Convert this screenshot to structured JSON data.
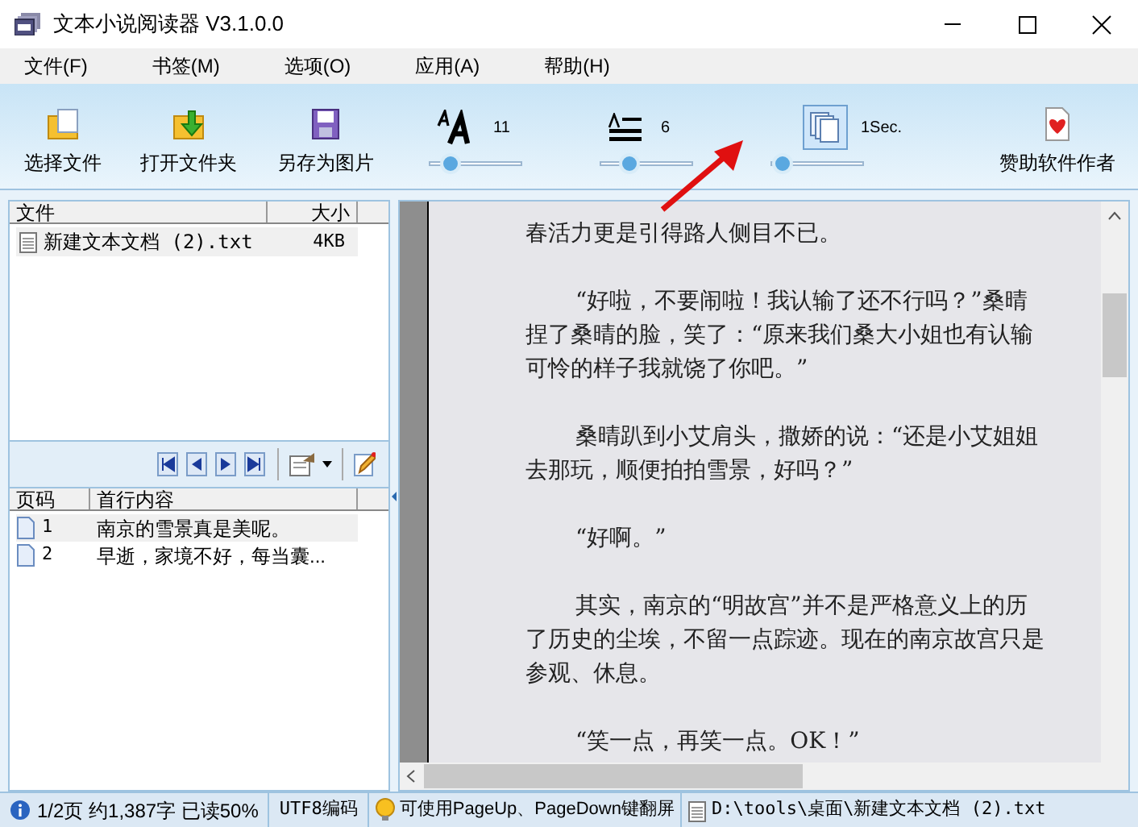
{
  "window": {
    "title": "文本小说阅读器 V3.1.0.0"
  },
  "menu": [
    "文件(F)",
    "书签(M)",
    "选项(O)",
    "应用(A)",
    "帮助(H)"
  ],
  "toolbar": {
    "buttons": [
      {
        "label": "选择文件",
        "kind": "folder"
      },
      {
        "label": "打开文件夹",
        "kind": "open"
      },
      {
        "label": "另存为图片",
        "kind": "save"
      }
    ],
    "sliders": [
      {
        "kind": "font",
        "reading": "11",
        "level": 0.2,
        "active": false
      },
      {
        "kind": "spacing",
        "reading": "6",
        "level": 0.3,
        "active": false
      },
      {
        "kind": "scroll",
        "reading": "1Sec.",
        "level": 0.1,
        "active": true
      }
    ],
    "sponsor": "赞助软件作者"
  },
  "files": {
    "columns": [
      "文件",
      "大小"
    ],
    "rows": [
      {
        "name": "新建文本文档 (2).txt",
        "size": "4KB"
      }
    ]
  },
  "bookmarks": {
    "columns": [
      "页码",
      "首行内容"
    ],
    "rows": [
      {
        "page": "1",
        "text": "南京的雪景真是美呢。"
      },
      {
        "page": "2",
        "text": "早逝，家境不好，每当囊..."
      }
    ]
  },
  "reader": {
    "paragraphs": [
      {
        "indent": false,
        "lines": [
          "春活力更是引得路人侧目不已。"
        ]
      },
      {
        "indent": true,
        "lines": [
          "“好啦，不要闹啦！我认输了还不行吗？”桑晴",
          "捏了桑晴的脸，笑了：“原来我们桑大小姐也有认输",
          "可怜的样子我就饶了你吧。”"
        ]
      },
      {
        "indent": true,
        "lines": [
          "桑晴趴到小艾肩头，撒娇的说：“还是小艾姐姐",
          "去那玩，顺便拍拍雪景，好吗？”"
        ]
      },
      {
        "indent": true,
        "lines": [
          "“好啊。”"
        ]
      },
      {
        "indent": true,
        "lines": [
          "其实，南京的“明故宫”并不是严格意义上的历",
          "了历史的尘埃，不留一点踪迹。现在的南京故宫只是",
          "参观、休息。"
        ]
      },
      {
        "indent": true,
        "lines": [
          "“笑一点，再笑一点。OK！”"
        ]
      }
    ]
  },
  "status_bar": {
    "progress": "1/2页 约1,387字 已读50%",
    "encoding": "UTF8编码",
    "tip": "可使用PageUp、PageDown键翻屏",
    "path": "D:\\tools\\桌面\\新建文本文档 (2).txt"
  }
}
